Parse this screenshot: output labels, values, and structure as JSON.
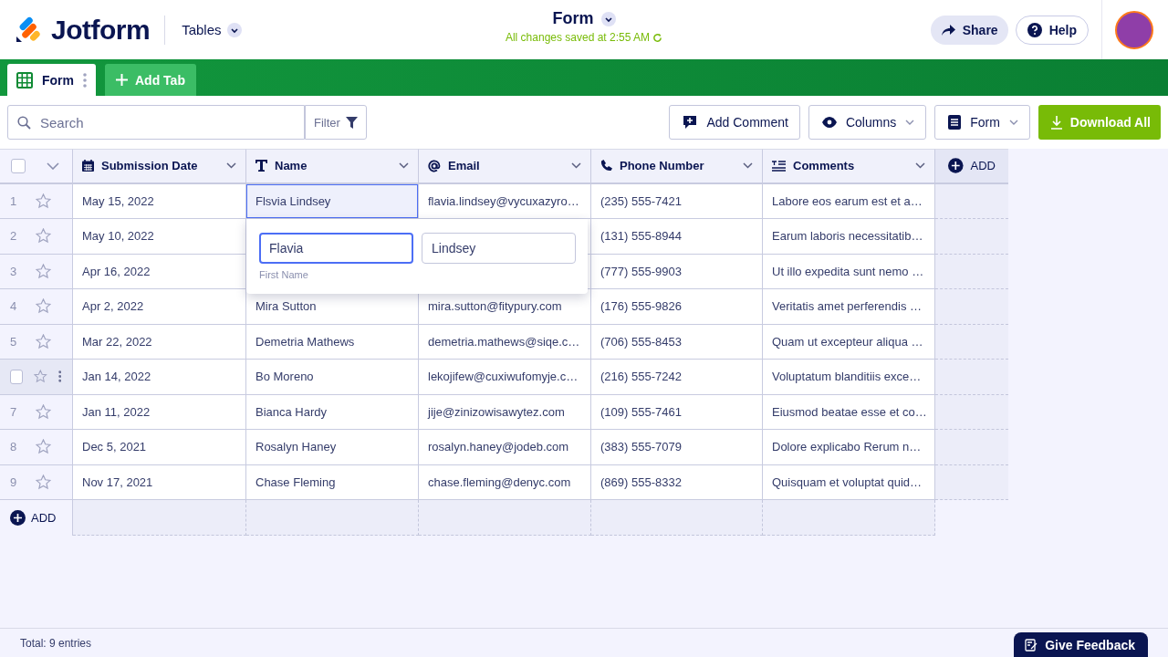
{
  "header": {
    "brand": "Jotform",
    "product": "Tables",
    "title": "Form",
    "save_status": "All changes saved at 2:55 AM",
    "share": "Share",
    "help": "Help"
  },
  "tabs": [
    {
      "label": "Form",
      "selected": true
    }
  ],
  "add_tab": "Add Tab",
  "toolbar": {
    "search_placeholder": "Search",
    "filter": "Filter",
    "add_comment": "Add Comment",
    "columns": "Columns",
    "form": "Form",
    "download": "Download All"
  },
  "select_all": {
    "checked": false
  },
  "columns": [
    {
      "label": "Submission Date",
      "kind": "date"
    },
    {
      "label": "Name",
      "kind": "text"
    },
    {
      "label": "Email",
      "kind": "email"
    },
    {
      "label": "Phone Number",
      "kind": "phone"
    },
    {
      "label": "Comments",
      "kind": "longtext"
    }
  ],
  "add_column": "ADD",
  "rows": [
    {
      "number": "1",
      "hovered": false,
      "starred": false,
      "cells": [
        {
          "text": "May 15, 2022",
          "selected": false
        },
        {
          "text": "Flsvia Lindsey",
          "selected": true
        },
        {
          "text": "flavia.lindsey@vycuxazyro…",
          "selected": false
        },
        {
          "text": "(235) 555-7421",
          "selected": false
        },
        {
          "text": "Labore eos earum est et a…",
          "selected": false
        }
      ]
    },
    {
      "number": "2",
      "hovered": false,
      "starred": false,
      "cells": [
        {
          "text": "May 10, 2022",
          "selected": false
        },
        null,
        null,
        {
          "text": "(131) 555-8944",
          "selected": false
        },
        {
          "text": "Earum laboris necessitatib…",
          "selected": false
        }
      ]
    },
    {
      "number": "3",
      "hovered": false,
      "starred": false,
      "cells": [
        {
          "text": "Apr 16, 2022",
          "selected": false
        },
        null,
        null,
        {
          "text": "(777) 555-9903",
          "selected": false
        },
        {
          "text": "Ut illo expedita sunt nemo …",
          "selected": false
        }
      ]
    },
    {
      "number": "4",
      "hovered": false,
      "starred": false,
      "cells": [
        {
          "text": "Apr 2, 2022",
          "selected": false
        },
        {
          "text": "Mira Sutton",
          "selected": false
        },
        {
          "text": "mira.sutton@fitypury.com",
          "selected": false
        },
        {
          "text": "(176) 555-9826",
          "selected": false
        },
        {
          "text": "Veritatis amet perferendis …",
          "selected": false
        }
      ]
    },
    {
      "number": "5",
      "hovered": false,
      "starred": false,
      "cells": [
        {
          "text": "Mar 22, 2022",
          "selected": false
        },
        {
          "text": "Demetria Mathews",
          "selected": false
        },
        {
          "text": "demetria.mathews@siqe.c…",
          "selected": false
        },
        {
          "text": "(706) 555-8453",
          "selected": false
        },
        {
          "text": "Quam ut excepteur aliqua …",
          "selected": false
        }
      ]
    },
    {
      "hovered": true,
      "checked": false,
      "starred": false,
      "cells": [
        {
          "text": "Jan 14, 2022",
          "selected": false
        },
        {
          "text": "Bo Moreno",
          "selected": false
        },
        {
          "text": "lekojifew@cuxiwufomyje.c…",
          "selected": false
        },
        {
          "text": "(216) 555-7242",
          "selected": false
        },
        {
          "text": "Voluptatum blanditiis exce…",
          "selected": false
        }
      ]
    },
    {
      "number": "7",
      "hovered": false,
      "starred": false,
      "cells": [
        {
          "text": "Jan 11, 2022",
          "selected": false
        },
        {
          "text": "Bianca Hardy",
          "selected": false
        },
        {
          "text": "jije@zinizowisawytez.com",
          "selected": false
        },
        {
          "text": "(109) 555-7461",
          "selected": false
        },
        {
          "text": "Eiusmod beatae esse et co…",
          "selected": false
        }
      ]
    },
    {
      "number": "8",
      "hovered": false,
      "starred": false,
      "cells": [
        {
          "text": "Dec 5, 2021",
          "selected": false
        },
        {
          "text": "Rosalyn Haney",
          "selected": false
        },
        {
          "text": "rosalyn.haney@jodeb.com",
          "selected": false
        },
        {
          "text": "(383) 555-7079",
          "selected": false
        },
        {
          "text": "Dolore explicabo Rerum n…",
          "selected": false
        }
      ]
    },
    {
      "number": "9",
      "hovered": false,
      "starred": false,
      "cells": [
        {
          "text": "Nov 17, 2021",
          "selected": false
        },
        {
          "text": "Chase Fleming",
          "selected": false
        },
        {
          "text": "chase.fleming@denyc.com",
          "selected": false
        },
        {
          "text": "(869) 555-8332",
          "selected": false
        },
        {
          "text": "Quisquam et voluptat quid…",
          "selected": false
        }
      ]
    }
  ],
  "add_row": "ADD",
  "name_editor": {
    "first_name": "Flavia",
    "last_name": "Lindsey",
    "first_label": "First Name"
  },
  "status_bar": {
    "total": "Total: 9 entries",
    "feedback": "Give Feedback"
  }
}
